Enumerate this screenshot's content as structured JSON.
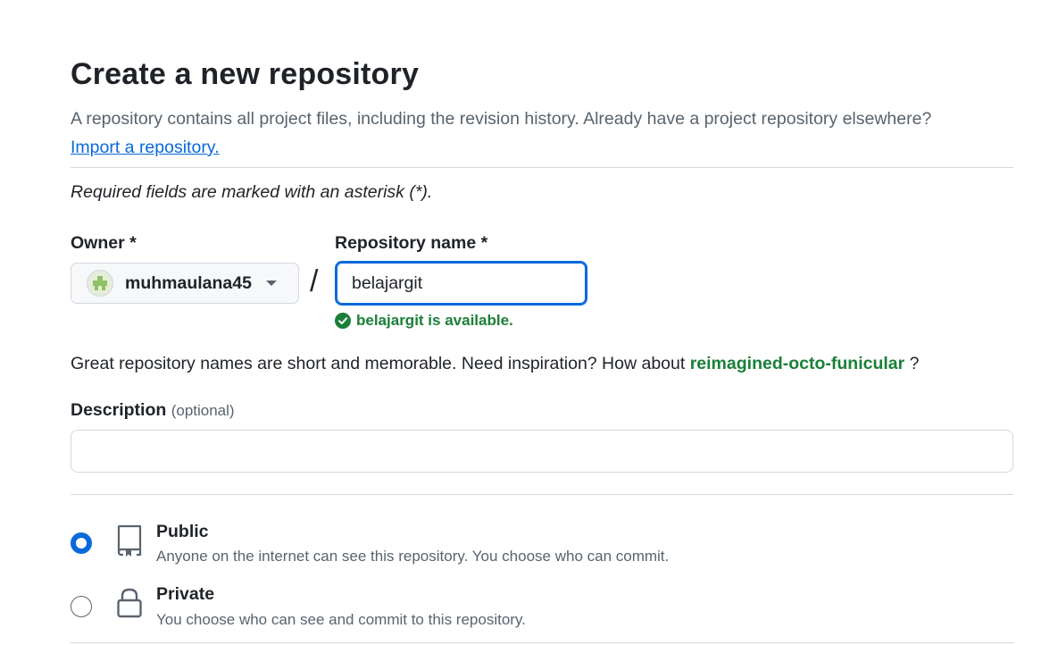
{
  "header": {
    "title": "Create a new repository",
    "subtitle": "A repository contains all project files, including the revision history. Already have a project repository elsewhere?",
    "import_link": "Import a repository."
  },
  "form": {
    "required_note": "Required fields are marked with an asterisk (*).",
    "owner": {
      "label": "Owner *",
      "value": "muhmaulana45",
      "avatar_icon": "identicon"
    },
    "separator": "/",
    "repo_name": {
      "label": "Repository name *",
      "value": "belajargit",
      "availability": "belajargit is available."
    },
    "suggestion": {
      "text": "Great repository names are short and memorable. Need inspiration? How about",
      "name": "reimagined-octo-funicular",
      "suffix": "?"
    },
    "description": {
      "label": "Description",
      "optional": "(optional)",
      "value": ""
    },
    "visibility": [
      {
        "title": "Public",
        "description": "Anyone on the internet can see this repository. You choose who can commit.",
        "icon": "repo-icon",
        "selected": true
      },
      {
        "title": "Private",
        "description": "You choose who can see and commit to this repository.",
        "icon": "lock-icon",
        "selected": false
      }
    ]
  },
  "colors": {
    "accent": "#0969da",
    "success": "#1a7f37",
    "muted": "#59636e",
    "border": "#d1d9e0"
  }
}
